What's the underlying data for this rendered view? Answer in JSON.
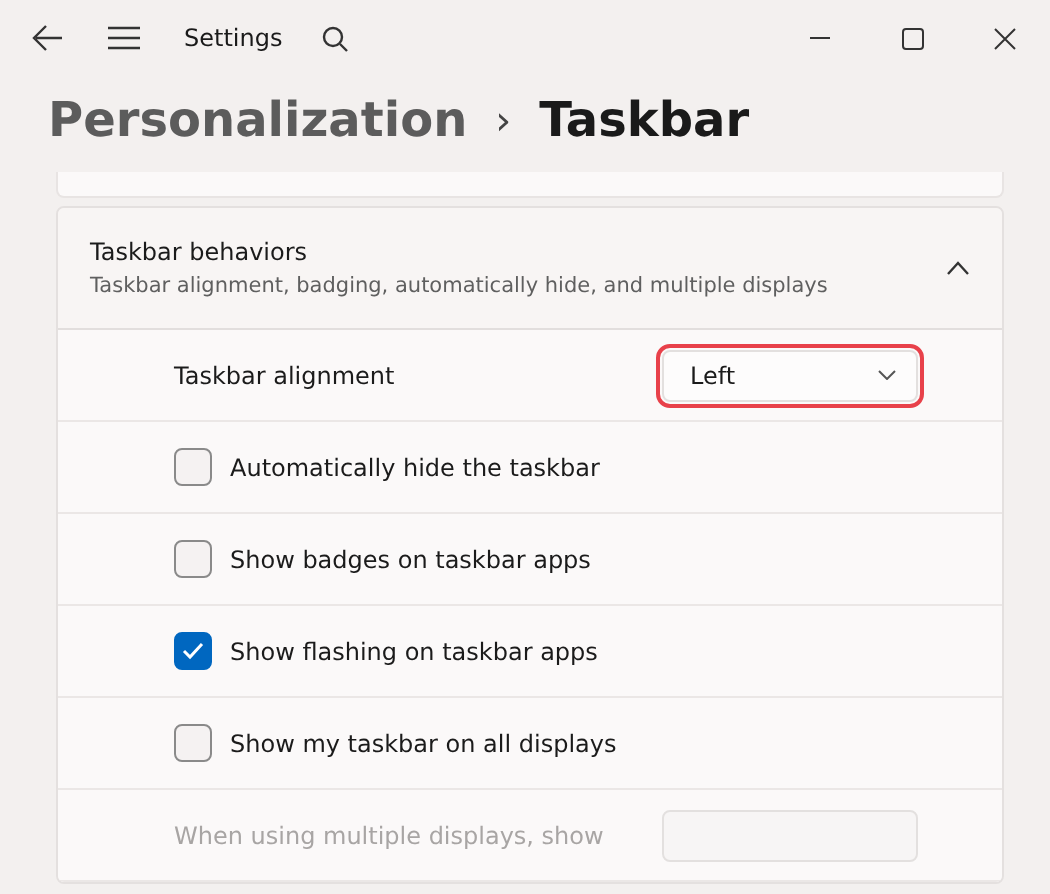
{
  "window": {
    "title": "Settings"
  },
  "breadcrumb": {
    "parent": "Personalization",
    "separator": "›",
    "current": "Taskbar"
  },
  "section": {
    "title": "Taskbar behaviors",
    "subtitle": "Taskbar alignment, badging, automatically hide, and multiple displays",
    "expanded": true
  },
  "settings": [
    {
      "kind": "dropdown",
      "label": "Taskbar alignment",
      "value": "Left",
      "highlighted": true,
      "disabled": false
    },
    {
      "kind": "checkbox",
      "label": "Automatically hide the taskbar",
      "checked": false,
      "disabled": false
    },
    {
      "kind": "checkbox",
      "label": "Show badges on taskbar apps",
      "checked": false,
      "disabled": false
    },
    {
      "kind": "checkbox",
      "label": "Show flashing on taskbar apps",
      "checked": true,
      "disabled": false
    },
    {
      "kind": "checkbox",
      "label": "Show my taskbar on all displays",
      "checked": false,
      "disabled": false
    },
    {
      "kind": "dropdown",
      "label": "When using multiple displays, show",
      "highlighted": false,
      "disabled": true
    }
  ]
}
